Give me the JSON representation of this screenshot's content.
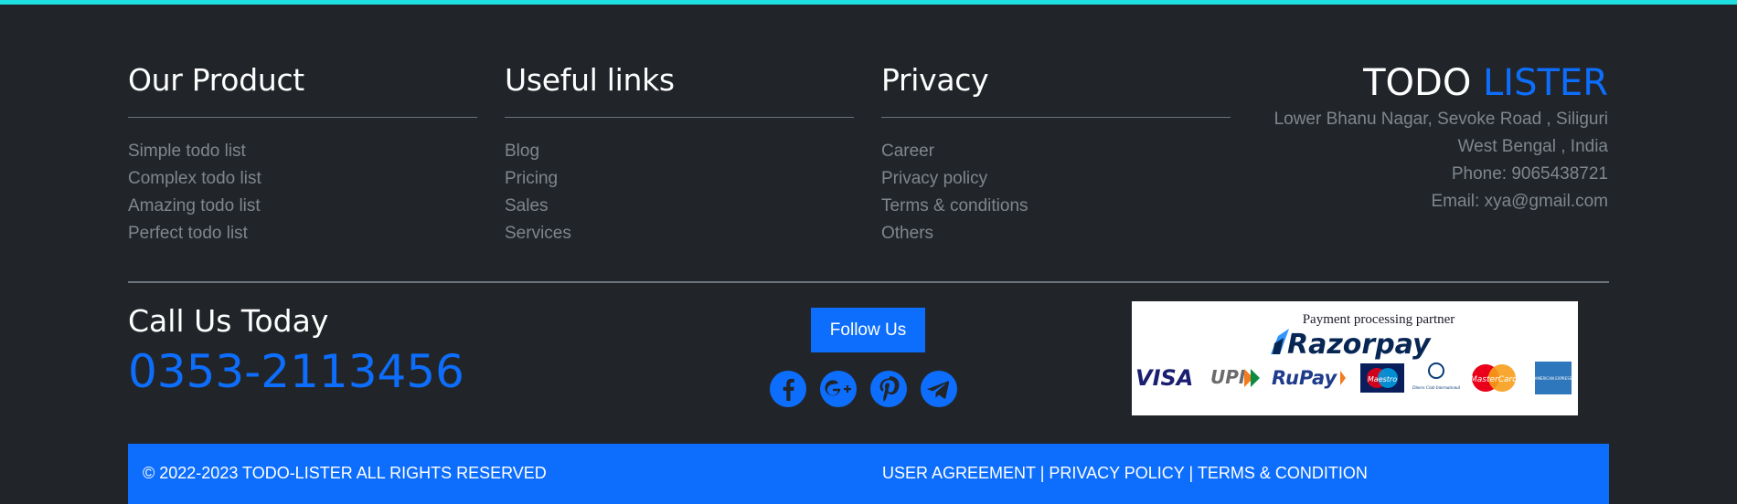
{
  "columns": [
    {
      "title": "Our Product",
      "items": [
        "Simple todo list",
        "Complex todo list",
        "Amazing todo list",
        "Perfect todo list"
      ]
    },
    {
      "title": "Useful links",
      "items": [
        "Blog",
        "Pricing",
        "Sales",
        "Services"
      ]
    },
    {
      "title": "Privacy",
      "items": [
        "Career",
        "Privacy policy",
        "Terms & conditions",
        "Others"
      ]
    }
  ],
  "brand": {
    "logo_main": "TODO",
    "logo_accent": "LISTER",
    "address_line1": "Lower Bhanu Nagar, Sevoke Road , Siliguri",
    "address_line2": "West Bengal , India",
    "phone": "Phone: 9065438721",
    "email": "Email: xya@gmail.com"
  },
  "call": {
    "title": "Call Us Today",
    "number": "0353-2113456"
  },
  "follow": {
    "label": "Follow Us",
    "icons": [
      "facebook-icon",
      "google-plus-icon",
      "pinterest-icon",
      "telegram-icon"
    ]
  },
  "payment": {
    "caption": "Payment processing partner",
    "provider": "Razorpay",
    "methods": [
      "VISA",
      "UPI",
      "RuPay",
      "Maestro",
      "Diners Club International",
      "MasterCard",
      "AMERICAN EXPRESS"
    ]
  },
  "bottom": {
    "copyright": "© 2022-2023 TODO-LISTER ALL RIGHTS RESERVED",
    "links": [
      "USER AGREEMENT",
      "PRIVACY POLICY",
      "TERMS & CONDITION"
    ],
    "separator": " | "
  },
  "colors": {
    "accent": "#0d6efd",
    "background": "#212529",
    "top_bar": "#1ee0e0",
    "muted_text": "#7f868c"
  }
}
